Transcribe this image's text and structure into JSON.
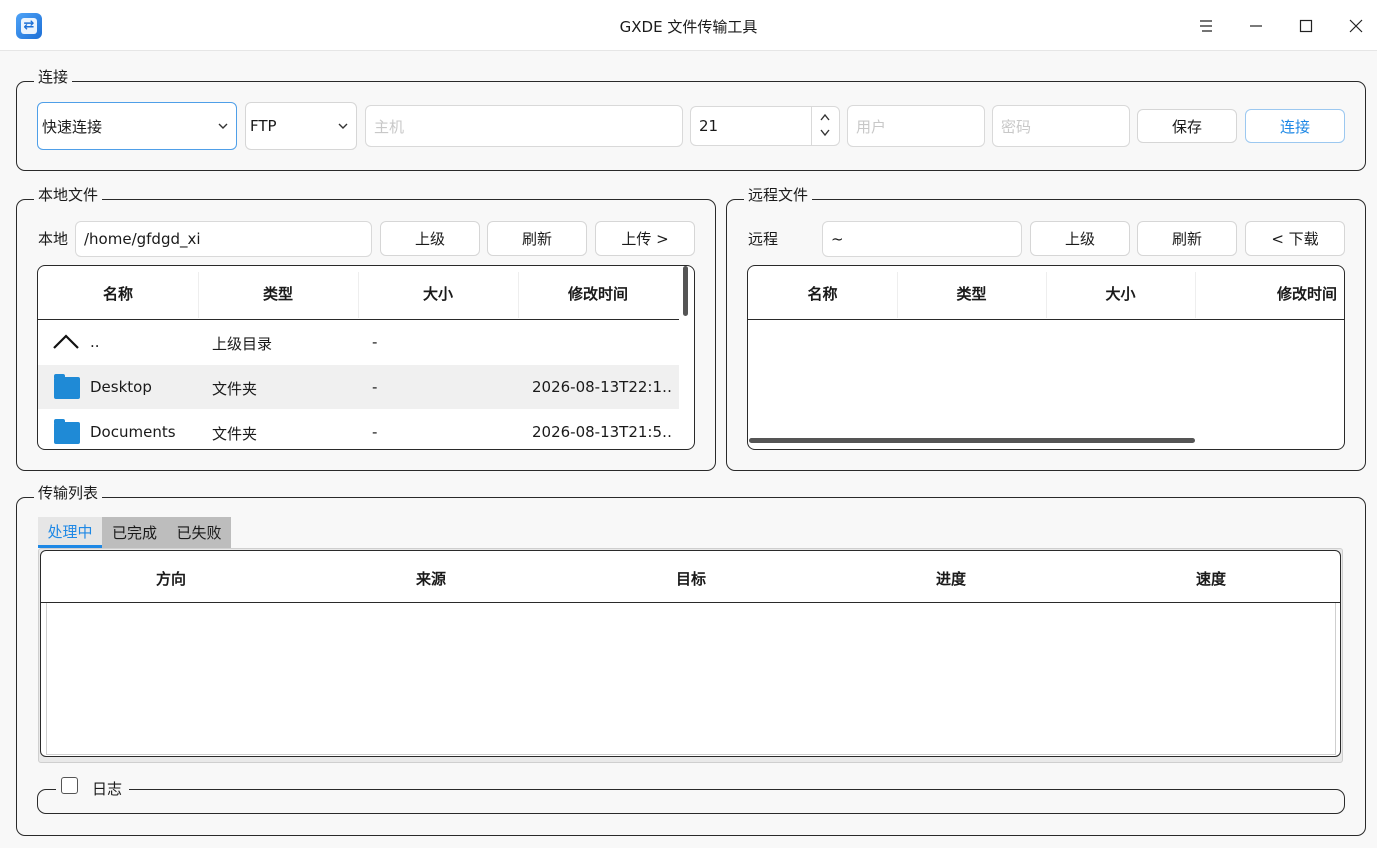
{
  "window": {
    "title": "GXDE 文件传输工具",
    "app_icon": "transfer-app-icon",
    "controls": [
      "menu-icon",
      "minimize-icon",
      "maximize-icon",
      "close-icon"
    ]
  },
  "connection": {
    "group_title": "连接",
    "profile_value": "快速连接",
    "protocol_value": "FTP",
    "host_placeholder": "主机",
    "port_value": "21",
    "user_placeholder": "用户",
    "password_placeholder": "密码",
    "save_label": "保存",
    "connect_label": "连接"
  },
  "local": {
    "group_title": "本地文件",
    "path_label": "本地",
    "path_value": "/home/gfdgd_xi",
    "up_label": "上级",
    "refresh_label": "刷新",
    "upload_label": "上传 >",
    "columns": [
      "名称",
      "类型",
      "大小",
      "修改时间"
    ],
    "rows": [
      {
        "icon": "parent-dir-icon",
        "name": "..",
        "type": "上级目录",
        "size": "-",
        "mtime": ""
      },
      {
        "icon": "folder-icon",
        "name": "Desktop",
        "type": "文件夹",
        "size": "-",
        "mtime": "2026-08-13T22:1…"
      },
      {
        "icon": "folder-icon",
        "name": "Documents",
        "type": "文件夹",
        "size": "-",
        "mtime": "2026-08-13T21:5…"
      }
    ]
  },
  "remote": {
    "group_title": "远程文件",
    "path_label": "远程",
    "path_value": "~",
    "up_label": "上级",
    "refresh_label": "刷新",
    "download_label": "< 下载",
    "columns": [
      "名称",
      "类型",
      "大小",
      "修改时间"
    ]
  },
  "transfer": {
    "group_title": "传输列表",
    "tabs": [
      "处理中",
      "已完成",
      "已失败"
    ],
    "active_tab": 0,
    "columns": [
      "方向",
      "来源",
      "目标",
      "进度",
      "速度"
    ]
  },
  "log": {
    "label": "日志",
    "checked": false
  },
  "colors": {
    "accent": "#1e88e5",
    "folder": "#1f8ad6",
    "selected_row": "#f0f0f0"
  }
}
